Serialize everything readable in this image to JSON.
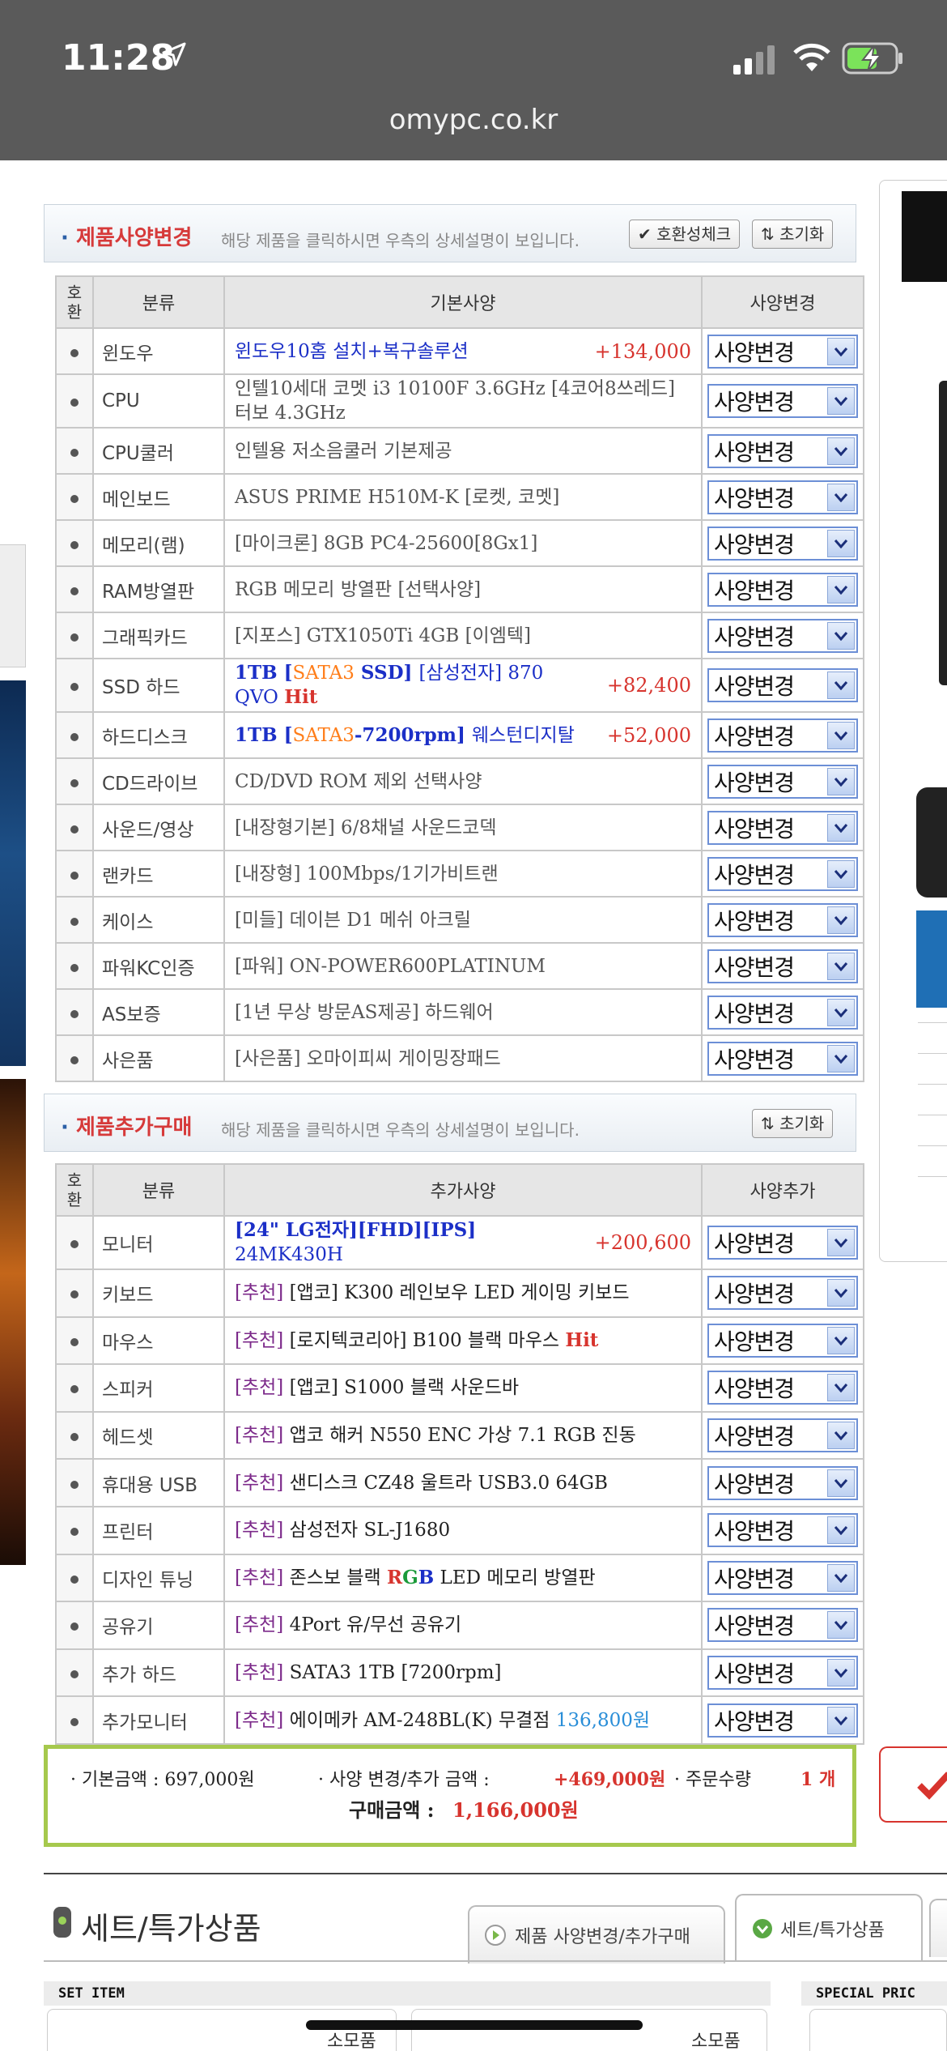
{
  "status_bar": {
    "time": "11:28"
  },
  "url": "omypc.co.kr",
  "spec_section": {
    "title_bold": "제품사양변경",
    "description": "해당 제품을 클릭하시면 우측의 상세설명이 보입니다.",
    "check_button": "호환성체크",
    "reset_button": "초기화",
    "headers": {
      "compat": "호환",
      "category": "분류",
      "spec": "기본사양",
      "change": "사양변경"
    },
    "rows": [
      {
        "category": "윈도우",
        "parts": [
          {
            "t": "윈도우10홈 설치+복구솔루션",
            "c": "blue"
          }
        ],
        "price": "+134,000",
        "select": "사양변경"
      },
      {
        "category": "CPU",
        "parts": [
          {
            "t": "인텔10세대 코멧 i3 10100F 3.6GHz [4코어8쓰레드] 터보 4.3GHz",
            "c": ""
          }
        ],
        "price": "",
        "select": "사양변경"
      },
      {
        "category": "CPU쿨러",
        "parts": [
          {
            "t": "인텔용 저소음쿨러 기본제공",
            "c": ""
          }
        ],
        "price": "",
        "select": "사양변경"
      },
      {
        "category": "메인보드",
        "parts": [
          {
            "t": "ASUS PRIME H510M-K [로켓, 코멧]",
            "c": ""
          }
        ],
        "price": "",
        "select": "사양변경"
      },
      {
        "category": "메모리(램)",
        "parts": [
          {
            "t": "[마이크론] 8GB PC4-25600[8Gx1]",
            "c": ""
          }
        ],
        "price": "",
        "select": "사양변경"
      },
      {
        "category": "RAM방열판",
        "parts": [
          {
            "t": "RGB 메모리 방열판 [선택사양]",
            "c": ""
          }
        ],
        "price": "",
        "select": "사양변경"
      },
      {
        "category": "그래픽카드",
        "parts": [
          {
            "t": "[지포스] GTX1050Ti 4GB [이엠텍]",
            "c": ""
          }
        ],
        "price": "",
        "select": "사양변경"
      },
      {
        "category": "SSD 하드",
        "parts": [
          {
            "t": "1TB [",
            "c": "bblue"
          },
          {
            "t": "SATA3",
            "c": "orange"
          },
          {
            "t": " SSD] ",
            "c": "bblue"
          },
          {
            "t": "[삼성전자] 870 QVO ",
            "c": "blue"
          },
          {
            "t": "Hit",
            "c": "red"
          }
        ],
        "price": "+82,400",
        "select": "사양변경"
      },
      {
        "category": "하드디스크",
        "parts": [
          {
            "t": "1TB [",
            "c": "bblue"
          },
          {
            "t": "SATA3",
            "c": "orange"
          },
          {
            "t": "-7200rpm] ",
            "c": "bblue"
          },
          {
            "t": "웨스턴디지탈",
            "c": "blue"
          }
        ],
        "price": "+52,000",
        "select": "사양변경"
      },
      {
        "category": "CD드라이브",
        "parts": [
          {
            "t": "CD/DVD ROM 제외 선택사양",
            "c": ""
          }
        ],
        "price": "",
        "select": "사양변경"
      },
      {
        "category": "사운드/영상",
        "parts": [
          {
            "t": "[내장형기본] 6/8채널 사운드코덱",
            "c": ""
          }
        ],
        "price": "",
        "select": "사양변경"
      },
      {
        "category": "랜카드",
        "parts": [
          {
            "t": "[내장형] 100Mbps/1기가비트랜",
            "c": ""
          }
        ],
        "price": "",
        "select": "사양변경"
      },
      {
        "category": "케이스",
        "parts": [
          {
            "t": "[미들] 데이븐 D1 메쉬 아크릴",
            "c": ""
          }
        ],
        "price": "",
        "select": "사양변경"
      },
      {
        "category": "파워KC인증",
        "parts": [
          {
            "t": "[파워] ON-POWER600PLATINUM",
            "c": ""
          }
        ],
        "price": "",
        "select": "사양변경"
      },
      {
        "category": "AS보증",
        "parts": [
          {
            "t": "[1년 무상 방문AS제공] 하드웨어",
            "c": ""
          }
        ],
        "price": "",
        "select": "사양변경"
      },
      {
        "category": "사은품",
        "parts": [
          {
            "t": "[사은품] 오마이피씨 게이밍장패드",
            "c": ""
          }
        ],
        "price": "",
        "select": "사양변경"
      }
    ]
  },
  "add_section": {
    "title_bold": "제품추가구매",
    "description": "해당 제품을 클릭하시면 우측의 상세설명이 보입니다.",
    "reset_button": "초기화",
    "headers": {
      "compat": "호환",
      "category": "분류",
      "spec": "추가사양",
      "change": "사양추가"
    },
    "rows": [
      {
        "category": "모니터",
        "parts": [
          {
            "t": "[24\" LG전자]",
            "c": "bblue"
          },
          {
            "t": "[FHD][IPS] ",
            "c": "bblue"
          },
          {
            "t": "24MK430H",
            "c": "blue"
          }
        ],
        "price": "+200,600",
        "select": "사양변경"
      },
      {
        "category": "키보드",
        "parts": [
          {
            "t": "[추천] ",
            "c": "purple"
          },
          {
            "t": "[앱코] K300 레인보우 LED 게이밍 키보드",
            "c": "black"
          }
        ],
        "price": "",
        "select": "사양변경"
      },
      {
        "category": "마우스",
        "parts": [
          {
            "t": "[추천] ",
            "c": "purple"
          },
          {
            "t": "[로지텍코리아] B100 블랙 마우스 ",
            "c": "black"
          },
          {
            "t": "Hit",
            "c": "red"
          }
        ],
        "price": "",
        "select": "사양변경"
      },
      {
        "category": "스피커",
        "parts": [
          {
            "t": "[추천] ",
            "c": "purple"
          },
          {
            "t": "[앱코] S1000 블랙 사운드바",
            "c": "black"
          }
        ],
        "price": "",
        "select": "사양변경"
      },
      {
        "category": "헤드셋",
        "parts": [
          {
            "t": "[추천] ",
            "c": "purple"
          },
          {
            "t": "앱코 해커 N550 ENC 가상 7.1 RGB 진동",
            "c": "black"
          }
        ],
        "price": "",
        "select": "사양변경"
      },
      {
        "category": "휴대용 USB",
        "parts": [
          {
            "t": "[추천] ",
            "c": "purple"
          },
          {
            "t": "샌디스크 CZ48 울트라 USB3.0 64GB",
            "c": "black"
          }
        ],
        "price": "",
        "select": "사양변경"
      },
      {
        "category": "프린터",
        "parts": [
          {
            "t": "[추천] ",
            "c": "purple"
          },
          {
            "t": "삼성전자 SL-J1680",
            "c": "black"
          }
        ],
        "price": "",
        "select": "사양변경"
      },
      {
        "category": "디자인 튜닝",
        "parts": [
          {
            "t": "[추천] ",
            "c": "purple"
          },
          {
            "t": "존스보 블랙 ",
            "c": "black"
          },
          {
            "t": "R",
            "c": "red"
          },
          {
            "t": "G",
            "c": "green"
          },
          {
            "t": "B",
            "c": "bblue"
          },
          {
            "t": " LED 메모리 방열판",
            "c": "black"
          }
        ],
        "price": "",
        "select": "사양변경"
      },
      {
        "category": "공유기",
        "parts": [
          {
            "t": "[추천] ",
            "c": "purple"
          },
          {
            "t": "4Port 유/무선 공유기",
            "c": "black"
          }
        ],
        "price": "",
        "select": "사양변경"
      },
      {
        "category": "추가 하드",
        "parts": [
          {
            "t": "[추천] ",
            "c": "purple"
          },
          {
            "t": "SATA3 1TB [7200rpm]",
            "c": "black"
          }
        ],
        "price": "",
        "select": "사양변경"
      },
      {
        "category": "추가모니터",
        "parts": [
          {
            "t": "[추천] ",
            "c": "purple"
          },
          {
            "t": "에이메카 AM-248BL(K) 무결점 ",
            "c": "black"
          },
          {
            "t": "136,800원",
            "c": "ltblue"
          }
        ],
        "price": "",
        "select": "사양변경"
      }
    ]
  },
  "summary": {
    "base_label": "· 기본금액 : 697,000원",
    "change_label": "· 사양 변경/추가 금액 :",
    "change_value": "+469,000원",
    "qty_label": "· 주문수량",
    "qty_value": "1 개",
    "total_label": "구매금액 :",
    "total_value": "1,166,000원"
  },
  "set_section": {
    "title": "세트/특가상품",
    "tab_spec": "제품 사양변경/추가구매",
    "tab_set": "세트/특가상품",
    "set_item_label": "SET ITEM",
    "special_label": "SPECIAL PRIC",
    "card_label_1": "소모품",
    "card_label_2": "소모품"
  },
  "colors": {
    "accent_blue": "#2b5fa6",
    "price_red": "#d7342e",
    "summary_border": "#a6c94d"
  }
}
